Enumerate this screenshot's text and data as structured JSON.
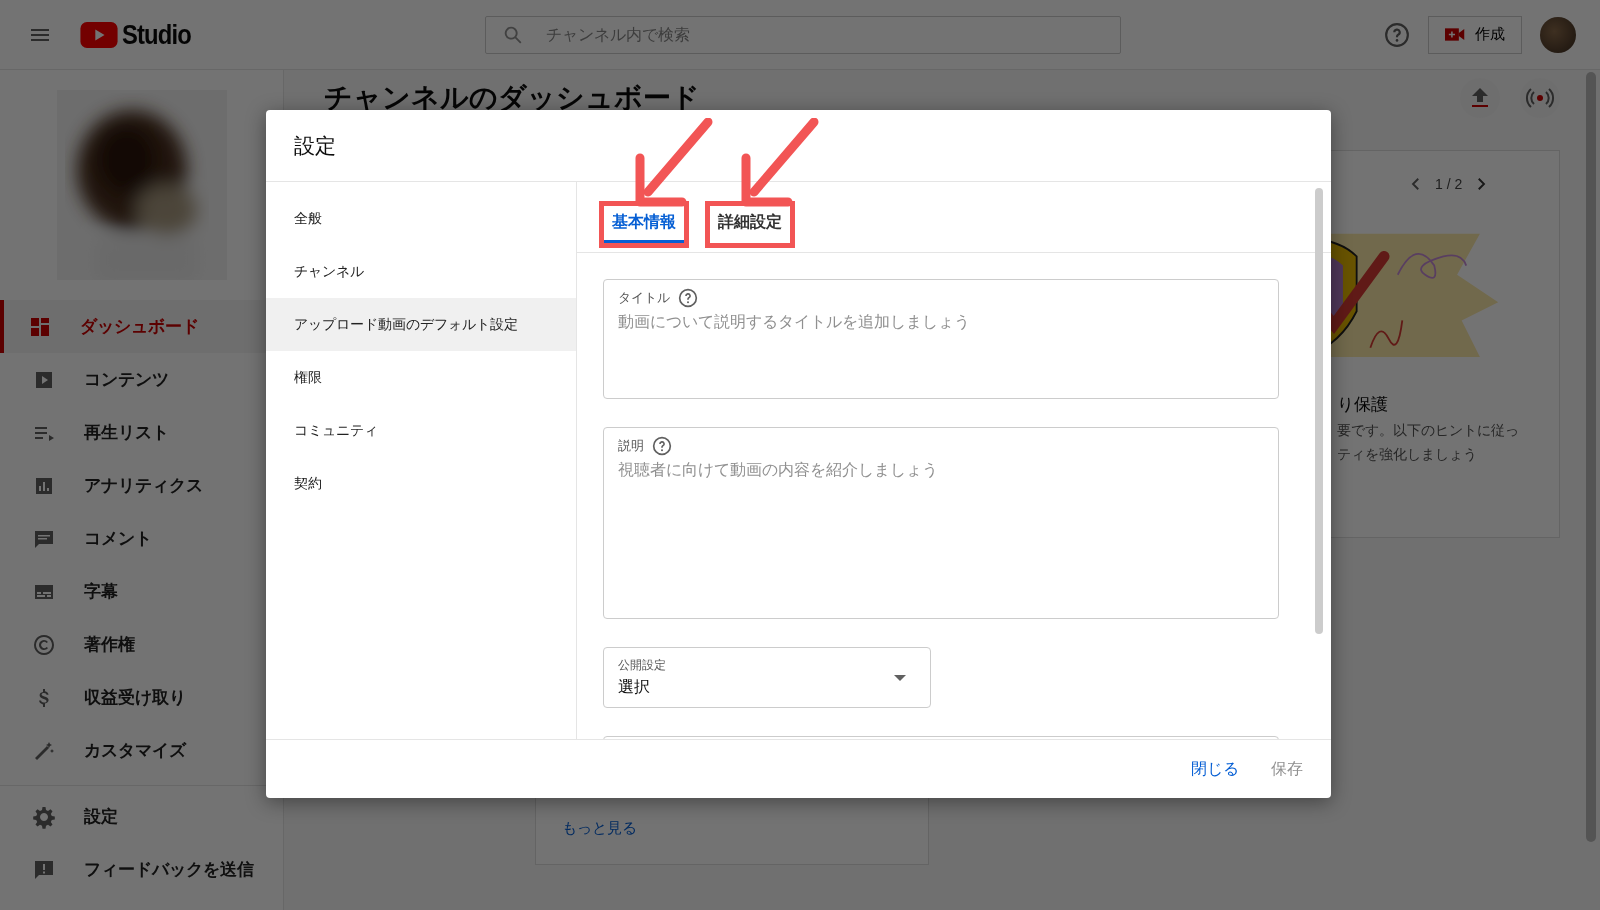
{
  "top_bar": {
    "logo_text": "Studio",
    "search": {
      "placeholder": "チャンネル内で検索"
    },
    "create_button": "作成"
  },
  "sidebar": {
    "items": [
      {
        "label": "ダッシュボード",
        "selected": true
      },
      {
        "label": "コンテンツ",
        "selected": false
      },
      {
        "label": "再生リスト",
        "selected": false
      },
      {
        "label": "アナリティクス",
        "selected": false
      },
      {
        "label": "コメント",
        "selected": false
      },
      {
        "label": "字幕",
        "selected": false
      },
      {
        "label": "著作権",
        "selected": false
      },
      {
        "label": "収益受け取り",
        "selected": false
      },
      {
        "label": "カスタマイズ",
        "selected": false
      }
    ],
    "footer_items": [
      {
        "label": "設定",
        "selected": false
      },
      {
        "label": "フィードバックを送信",
        "selected": false
      }
    ]
  },
  "background": {
    "page_title": "チャンネルのダッシュボード",
    "card": {
      "pager": "1 / 2",
      "title": "り保護",
      "body_lines": [
        "要です。以下のヒントに従っ",
        "ティを強化しましょう"
      ]
    },
    "more_link": "もっと見る"
  },
  "dialog": {
    "title": "設定",
    "nav": [
      {
        "label": "全般",
        "selected": false
      },
      {
        "label": "チャンネル",
        "selected": false
      },
      {
        "label": "アップロード動画のデフォルト設定",
        "selected": true
      },
      {
        "label": "権限",
        "selected": false
      },
      {
        "label": "コミュニティ",
        "selected": false
      },
      {
        "label": "契約",
        "selected": false
      }
    ],
    "tabs": [
      {
        "label": "基本情報",
        "selected": true,
        "annotated": true
      },
      {
        "label": "詳細設定",
        "selected": false,
        "annotated": true
      }
    ],
    "fields": [
      {
        "kind": "textarea",
        "label": "タイトル",
        "help": true,
        "placeholder": "動画について説明するタイトルを追加しましょう"
      },
      {
        "kind": "textarea",
        "label": "説明",
        "help": true,
        "placeholder": "視聴者に向けて動画の内容を紹介しましょう"
      },
      {
        "kind": "select",
        "label": "公開設定",
        "value": "選択"
      },
      {
        "kind": "clipped"
      }
    ],
    "buttons": [
      {
        "label": "閉じる",
        "disabled": false
      },
      {
        "label": "保存",
        "disabled": true
      }
    ]
  }
}
